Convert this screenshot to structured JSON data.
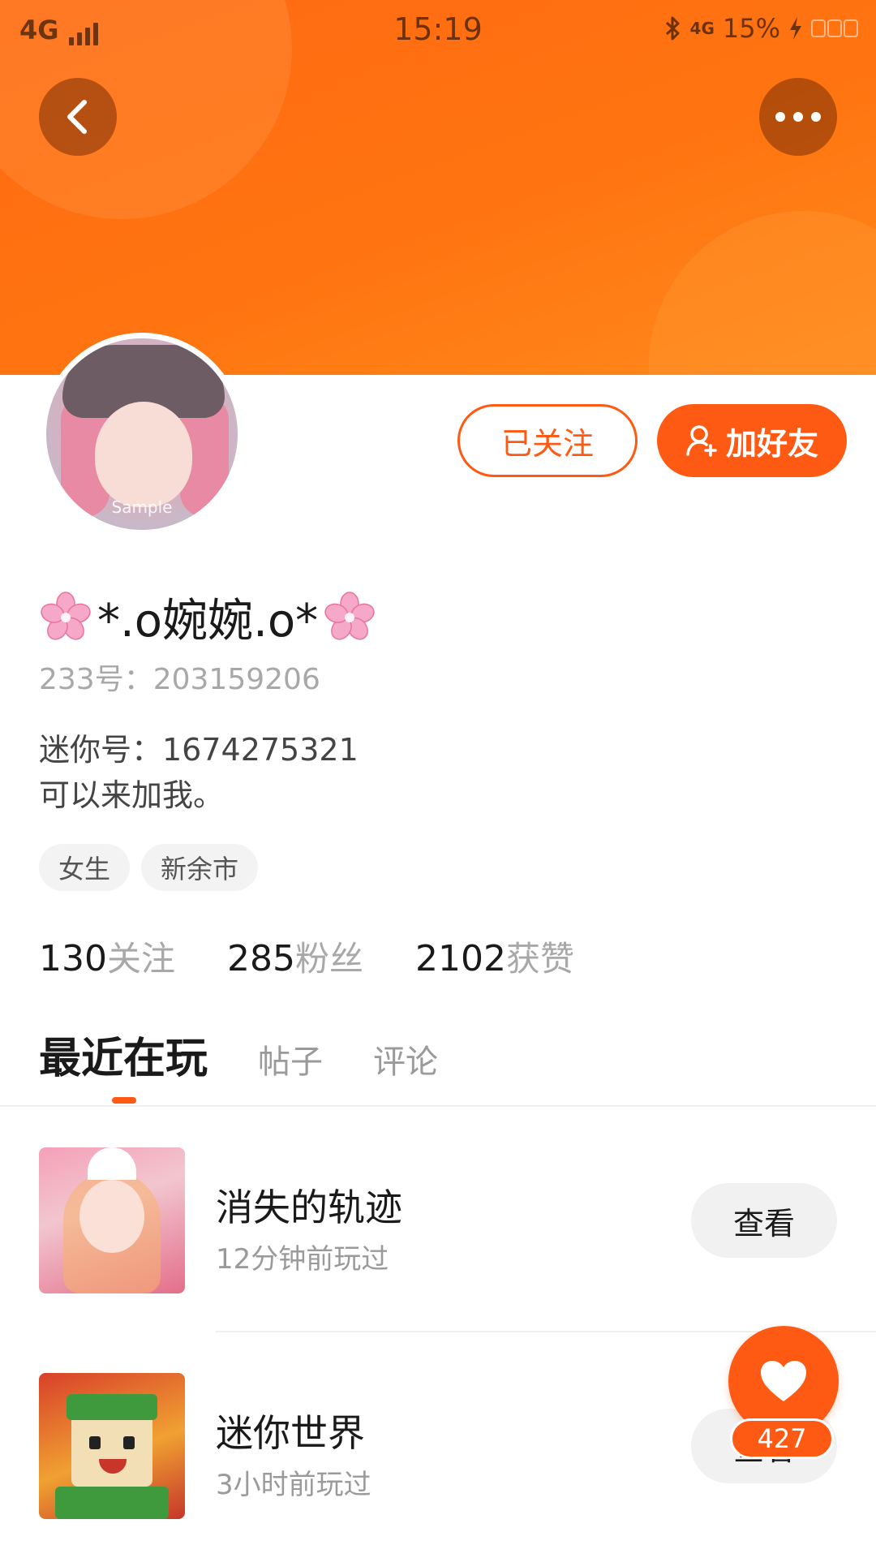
{
  "status_bar": {
    "network": "4G",
    "time": "15:19",
    "mini_network": "4G",
    "battery": "15%"
  },
  "header": {
    "back_icon": "chevron-left-icon",
    "more_icon": "more-dots-icon"
  },
  "profile": {
    "avatar_watermark": "Sample",
    "nickname": "*.o婉婉.o*",
    "id_label": "233号：",
    "id_value": "203159206",
    "bio_line1": "迷你号：1674275321",
    "bio_line2": "可以来加我。",
    "tags": [
      "女生",
      "新余市"
    ]
  },
  "actions": {
    "follow_label": "已关注",
    "add_friend_label": "加好友"
  },
  "stats": [
    {
      "num": "130",
      "label": "关注"
    },
    {
      "num": "285",
      "label": "粉丝"
    },
    {
      "num": "2102",
      "label": "获赞"
    }
  ],
  "tabs": [
    {
      "label": "最近在玩",
      "active": true
    },
    {
      "label": "帖子",
      "active": false
    },
    {
      "label": "评论",
      "active": false
    }
  ],
  "games": [
    {
      "title": "消失的轨迹",
      "subtitle": "12分钟前玩过",
      "action": "查看"
    },
    {
      "title": "迷你世界",
      "subtitle": "3小时前玩过",
      "action": "查看"
    }
  ],
  "like": {
    "count": "427"
  },
  "colors": {
    "accent": "#ff5a14",
    "cover_start": "#ff6a14",
    "cover_end": "#ff8a1c"
  }
}
